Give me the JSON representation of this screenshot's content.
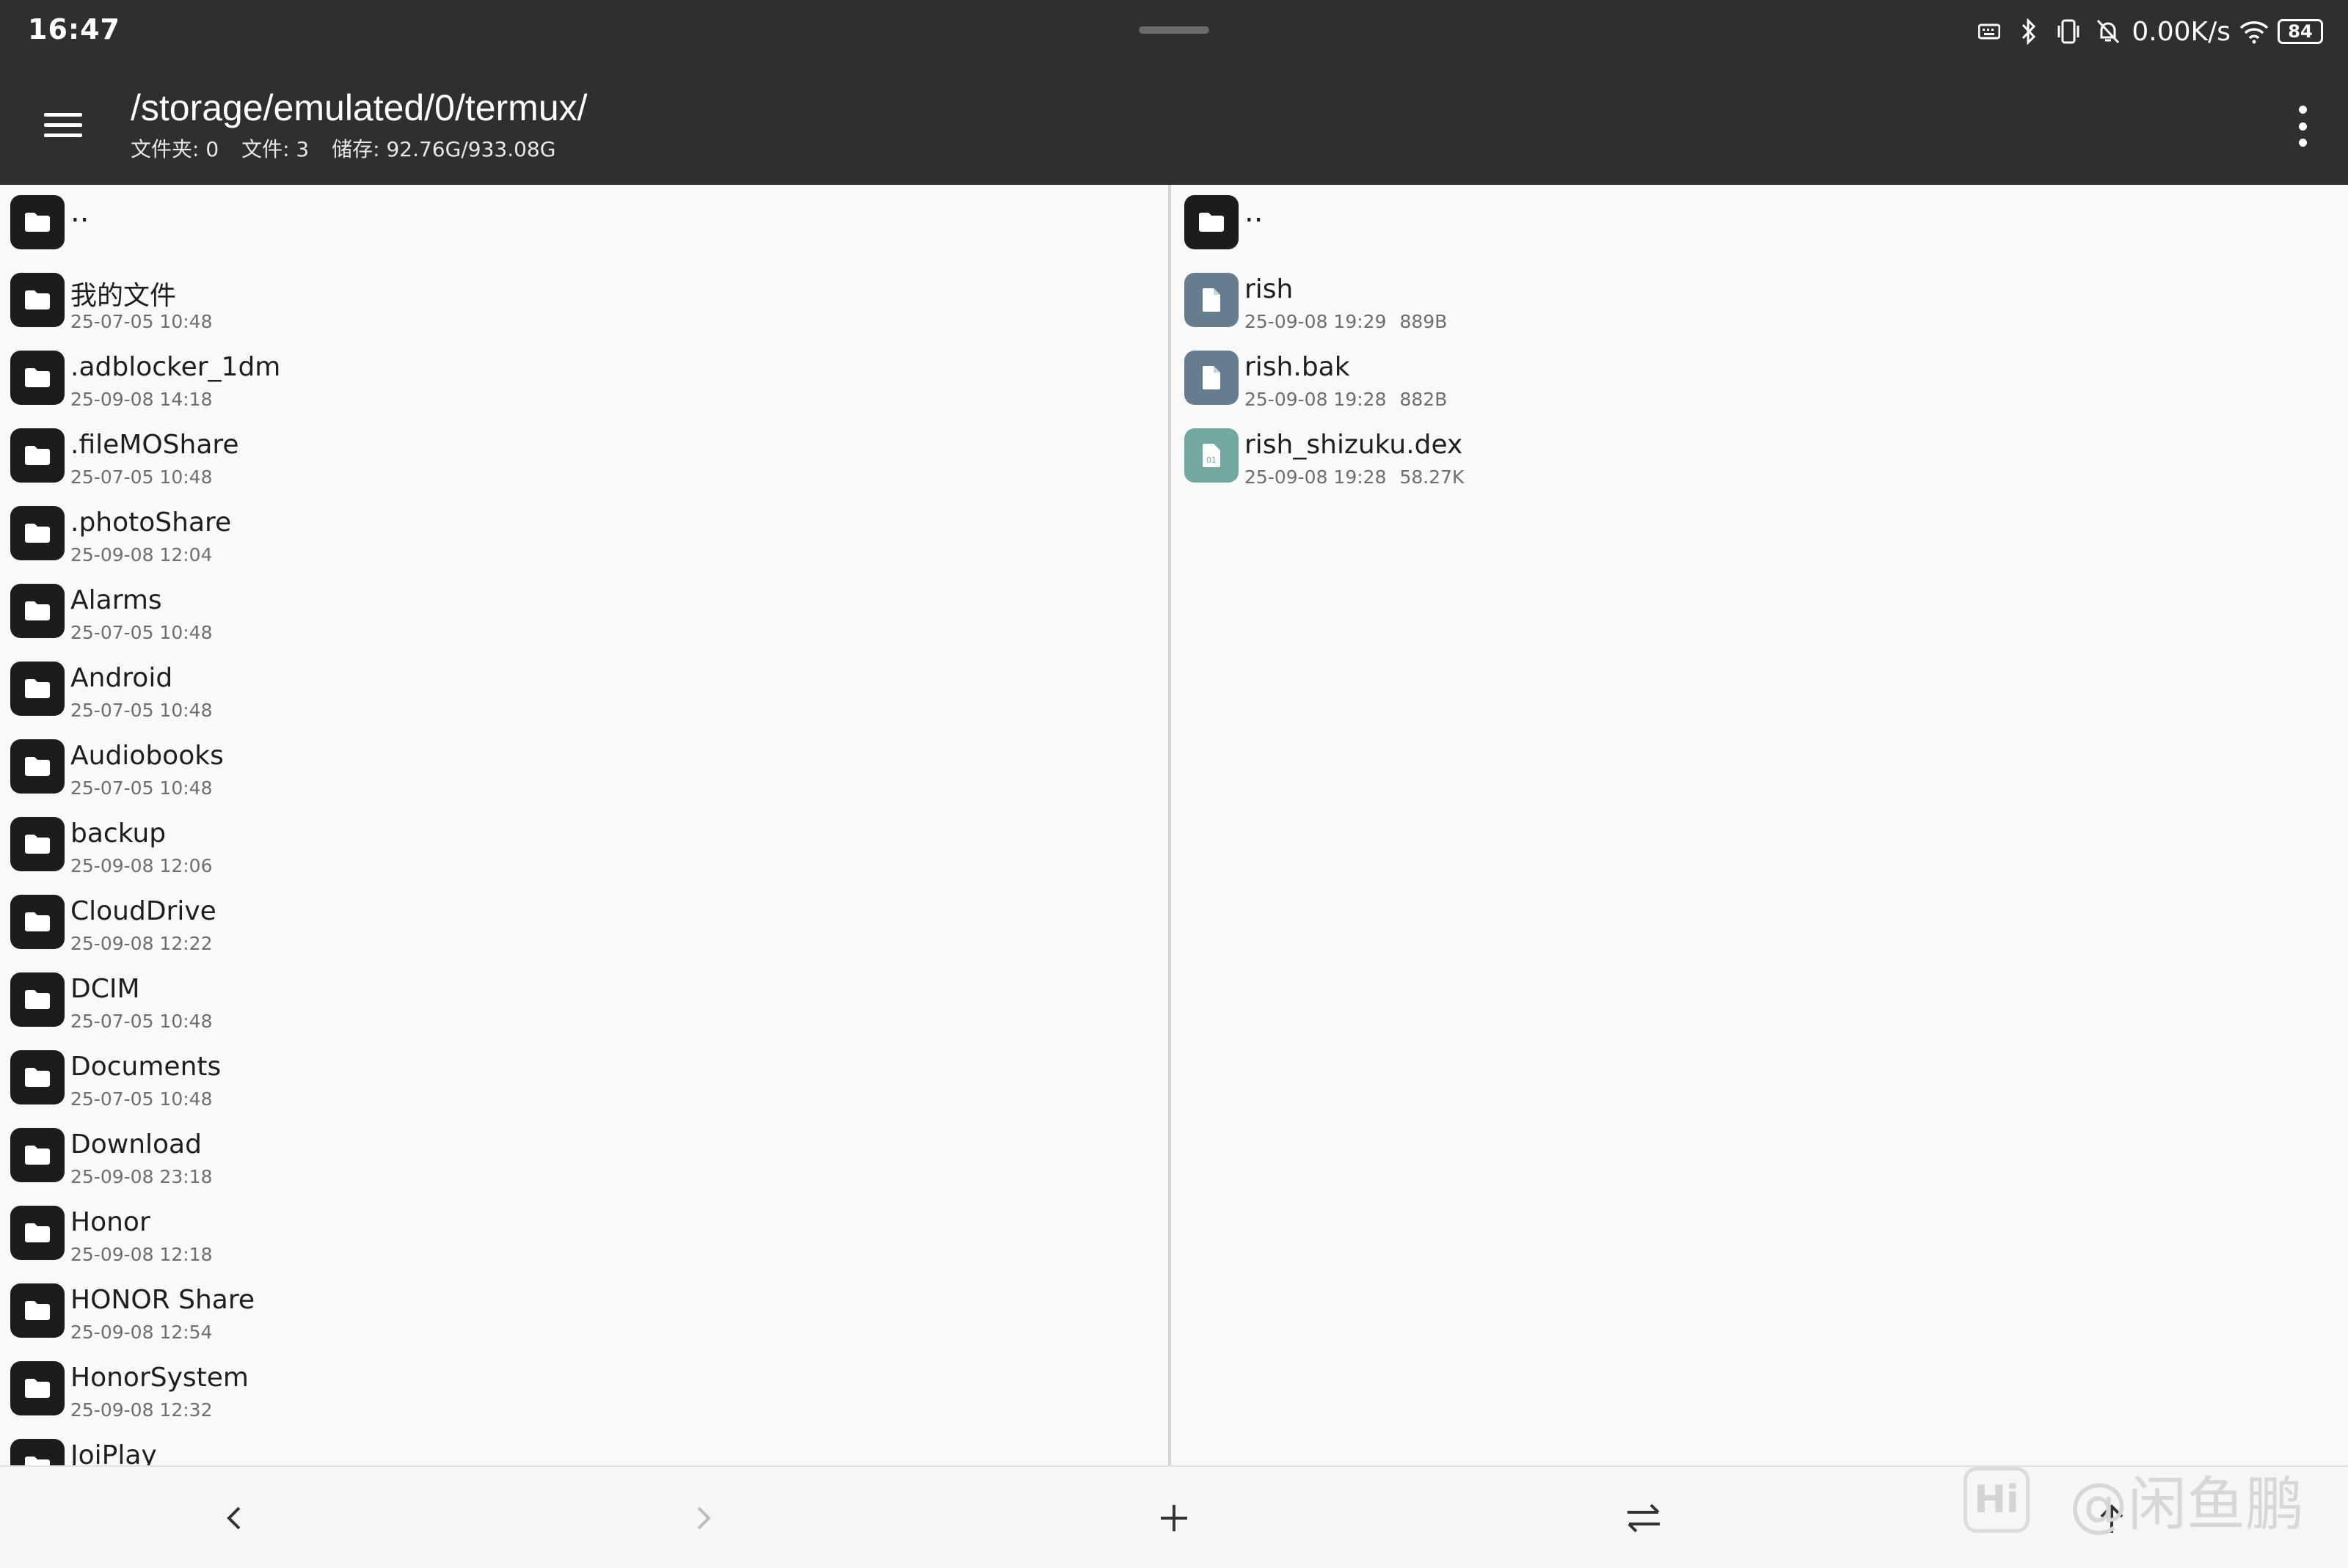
{
  "status_bar": {
    "time": "16:47",
    "net_speed": "0.00K/s",
    "battery": "84",
    "icons": [
      "keyboard-icon",
      "bluetooth-icon",
      "vibrate-icon",
      "silent-icon",
      "wifi-icon",
      "battery-icon"
    ]
  },
  "header": {
    "path": "/storage/emulated/0/termux/",
    "folders": "文件夹: 0",
    "files": "文件: 3",
    "storage": "储存: 92.76G/933.08G"
  },
  "left_pane": {
    "parent_label": "..",
    "items": [
      {
        "name": "我的文件",
        "date": "25-07-05 10:48"
      },
      {
        "name": ".adblocker_1dm",
        "date": "25-09-08 14:18"
      },
      {
        "name": ".fileMOShare",
        "date": "25-07-05 10:48"
      },
      {
        "name": ".photoShare",
        "date": "25-09-08 12:04"
      },
      {
        "name": "Alarms",
        "date": "25-07-05 10:48"
      },
      {
        "name": "Android",
        "date": "25-07-05 10:48"
      },
      {
        "name": "Audiobooks",
        "date": "25-07-05 10:48"
      },
      {
        "name": "backup",
        "date": "25-09-08 12:06"
      },
      {
        "name": "CloudDrive",
        "date": "25-09-08 12:22"
      },
      {
        "name": "DCIM",
        "date": "25-07-05 10:48"
      },
      {
        "name": "Documents",
        "date": "25-07-05 10:48"
      },
      {
        "name": "Download",
        "date": "25-09-08 23:18"
      },
      {
        "name": "Honor",
        "date": "25-09-08 12:18"
      },
      {
        "name": "HONOR Share",
        "date": "25-09-08 12:54"
      },
      {
        "name": "HonorSystem",
        "date": "25-09-08 12:32"
      },
      {
        "name": "JoiPlay",
        "date": ""
      }
    ]
  },
  "right_pane": {
    "parent_label": "..",
    "items": [
      {
        "name": "rish",
        "date": "25-09-08 19:29",
        "size": "889B",
        "kind": "file"
      },
      {
        "name": "rish.bak",
        "date": "25-09-08 19:28",
        "size": "882B",
        "kind": "file"
      },
      {
        "name": "rish_shizuku.dex",
        "date": "25-09-08 19:28",
        "size": "58.27K",
        "kind": "dex"
      }
    ]
  },
  "bottom_bar": {
    "buttons": [
      "back-icon",
      "forward-icon",
      "add-icon",
      "swap-icon",
      "up-icon"
    ]
  },
  "watermark": {
    "logo": "Hi",
    "text": "@闲鱼鹏"
  }
}
